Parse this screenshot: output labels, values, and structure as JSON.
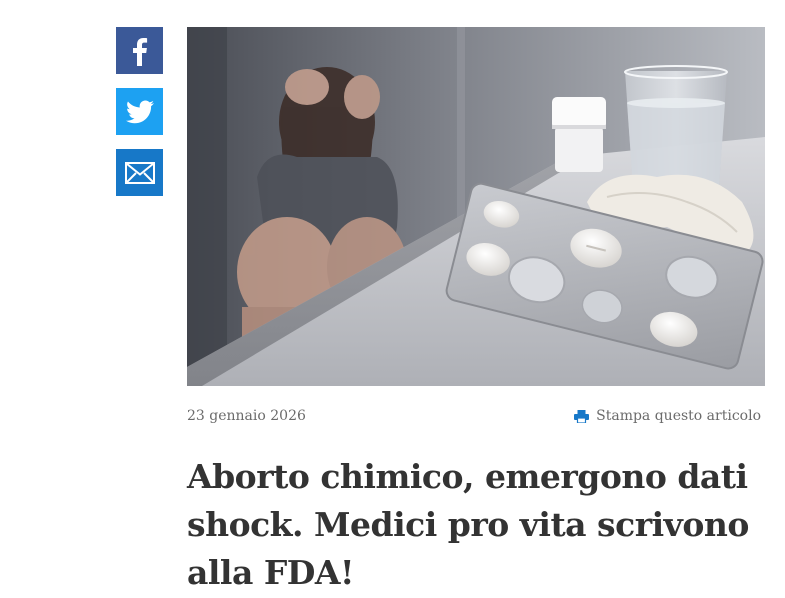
{
  "share": {
    "facebook_icon": "facebook-icon",
    "twitter_icon": "twitter-icon",
    "email_icon": "envelope-icon",
    "colors": {
      "facebook": "#3b5998",
      "twitter": "#1da1f2",
      "email": "#1778c8"
    }
  },
  "article": {
    "date": "23 gennaio 2026",
    "print_label": "Stampa questo articolo",
    "print_icon": "printer-icon",
    "print_icon_color": "#1778c8",
    "title": "Aborto chimico, emergono dati shock. Medici pro vita scrivono alla FDA!"
  }
}
